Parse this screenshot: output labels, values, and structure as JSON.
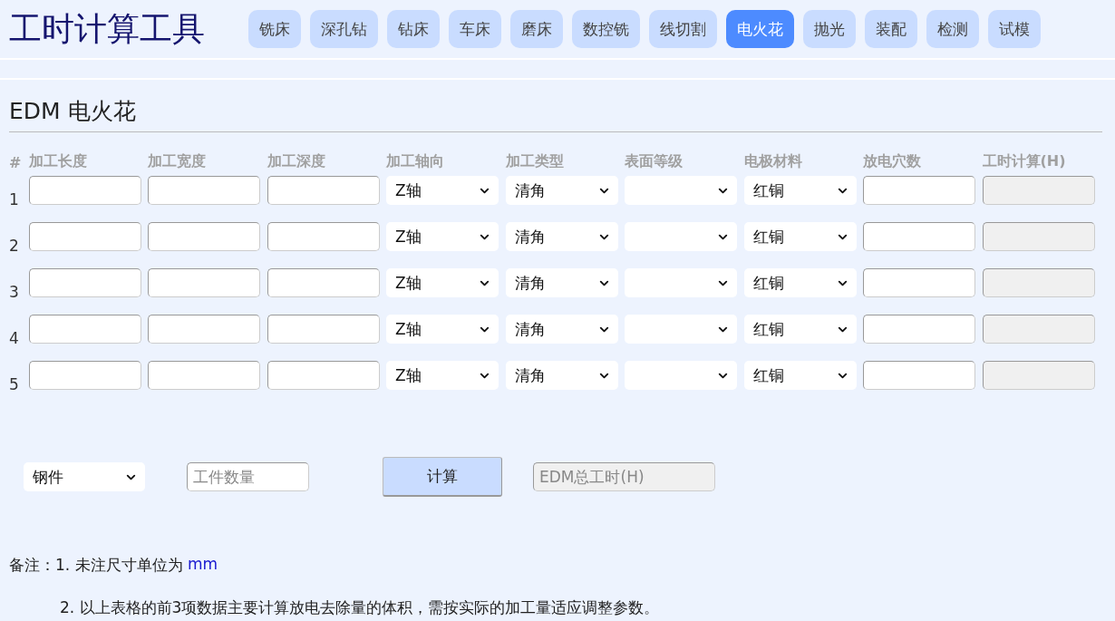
{
  "app_title": "工时计算工具",
  "tabs": [
    {
      "label": "铣床",
      "selected": false
    },
    {
      "label": "深孔钻",
      "selected": false
    },
    {
      "label": "钻床",
      "selected": false
    },
    {
      "label": "车床",
      "selected": false
    },
    {
      "label": "磨床",
      "selected": false
    },
    {
      "label": "数控铣",
      "selected": false
    },
    {
      "label": "线切割",
      "selected": false
    },
    {
      "label": "电火花",
      "selected": true
    },
    {
      "label": "抛光",
      "selected": false
    },
    {
      "label": "装配",
      "selected": false
    },
    {
      "label": "检测",
      "selected": false
    },
    {
      "label": "试模",
      "selected": false
    }
  ],
  "section_title": "EDM 电火花",
  "table": {
    "columns": [
      "#",
      "加工长度",
      "加工宽度",
      "加工深度",
      "加工轴向",
      "加工类型",
      "表面等级",
      "电极材料",
      "放电穴数",
      "工时计算(H)"
    ],
    "rows": [
      {
        "number": "1",
        "axis": "Z轴",
        "type": "清角",
        "material": "红铜"
      },
      {
        "number": "2",
        "axis": "Z轴",
        "type": "清角",
        "material": "红铜"
      },
      {
        "number": "3",
        "axis": "Z轴",
        "type": "清角",
        "material": "红铜"
      },
      {
        "number": "4",
        "axis": "Z轴",
        "type": "清角",
        "material": "红铜"
      },
      {
        "number": "5",
        "axis": "Z轴",
        "type": "清角",
        "material": "红铜"
      }
    ]
  },
  "totals": {
    "workpiece": "钢件",
    "quantity_placeholder": "工件数量",
    "button": "计算",
    "total_placeholder": "EDM总工时(H)"
  },
  "notes": {
    "label": "备注：",
    "items": [
      {
        "text": "1. 未注尺寸单位为 ",
        "unit": "mm"
      },
      {
        "text": "2. 以上表格的前3项数据主要计算放电去除量的体积，需按实际的加工量适应调整参数。"
      }
    ]
  }
}
